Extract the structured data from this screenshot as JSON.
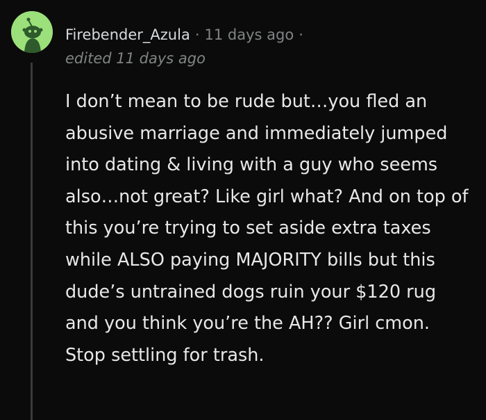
{
  "comment": {
    "author": "Firebender_Azula",
    "separator": "·",
    "timestamp": "11 days ago",
    "trailing_separator": "·",
    "edited": "edited 11 days ago",
    "body": "I don’t mean to be rude but…you fled an abusive marriage and immediately jumped into dating & living with a guy who seems also…not great? Like girl what? And on top of this you’re trying to set aside extra taxes while ALSO paying MAJORITY bills but this dude’s untrained dogs ruin your $120 rug and you think you’re the AH?? Girl cmon. Stop settling for trash.",
    "avatar_icon": "snoo-avatar-icon",
    "avatar_color": "#9be07a"
  }
}
